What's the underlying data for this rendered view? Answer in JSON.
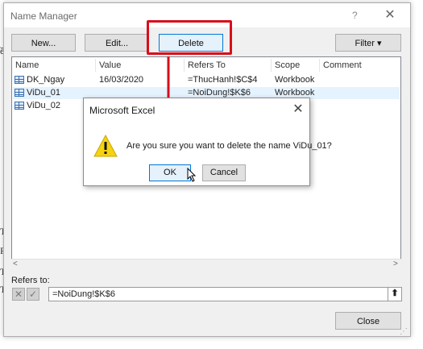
{
  "background_fragments": [
    "ề",
    "Ta",
    "Pl",
    "Ti",
    "Ti"
  ],
  "window": {
    "title": "Name Manager",
    "help_label": "?",
    "close_glyph": "✕"
  },
  "toolbar": {
    "new_label": "New...",
    "edit_label": "Edit...",
    "delete_label": "Delete",
    "filter_label": "Filter ▾"
  },
  "list": {
    "columns": [
      "Name",
      "Value",
      "Refers To",
      "Scope",
      "Comment"
    ],
    "rows": [
      {
        "name": "DK_Ngay",
        "value": "16/03/2020",
        "refers_to": "=ThucHanh!$C$4",
        "scope": "Workbook",
        "comment": ""
      },
      {
        "name": "ViDu_01",
        "value": "",
        "refers_to": "=NoiDung!$K$6",
        "scope": "Workbook",
        "comment": ""
      },
      {
        "name": "ViDu_02",
        "value": "",
        "refers_to": "",
        "scope": "",
        "comment": ""
      }
    ],
    "scroll_left_glyph": "<",
    "scroll_right_glyph": ">"
  },
  "refers": {
    "label": "Refers to:",
    "value": "=NoiDung!$K$6",
    "collapse_glyph": "⬆"
  },
  "close_button_label": "Close",
  "dialog": {
    "title": "Microsoft Excel",
    "close_glyph": "✕",
    "message": "Are you sure you want to delete the name ViDu_01?",
    "ok_label": "OK",
    "cancel_label": "Cancel"
  },
  "colors": {
    "highlight": "#d80e1b",
    "arrow": "#d80e1b",
    "warning": "#f5d312",
    "selected_row": "#e5f3ff",
    "focus_border": "#0078d7"
  }
}
